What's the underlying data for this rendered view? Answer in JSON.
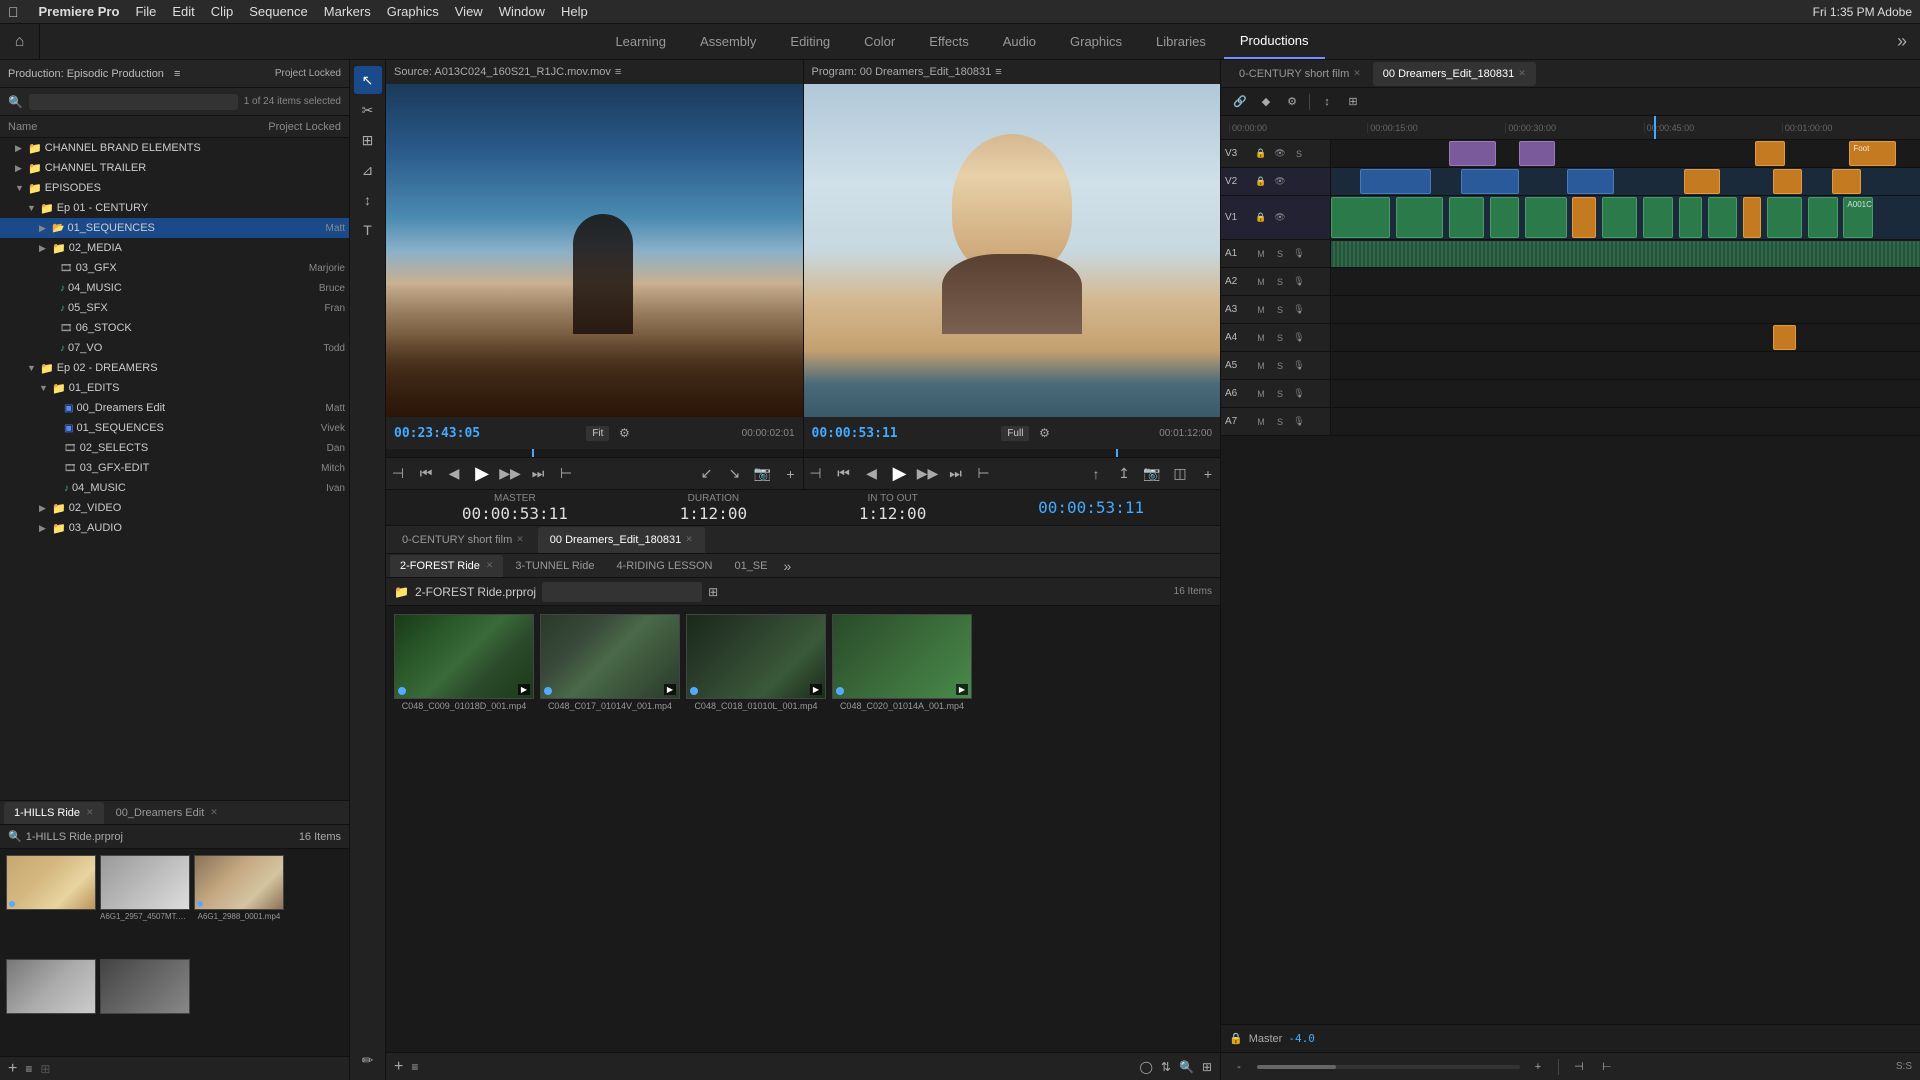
{
  "menubar": {
    "apple": "",
    "app_name": "Premiere Pro",
    "items": [
      "File",
      "Edit",
      "Clip",
      "Sequence",
      "Markers",
      "Graphics",
      "View",
      "Window",
      "Help"
    ],
    "right": "Fri 1:35 PM   Adobe"
  },
  "workspace": {
    "home_icon": "⌂",
    "tabs": [
      {
        "label": "Learning",
        "active": false
      },
      {
        "label": "Assembly",
        "active": false
      },
      {
        "label": "Editing",
        "active": false
      },
      {
        "label": "Color",
        "active": false
      },
      {
        "label": "Effects",
        "active": false
      },
      {
        "label": "Audio",
        "active": false
      },
      {
        "label": "Graphics",
        "active": false
      },
      {
        "label": "Libraries",
        "active": false
      },
      {
        "label": "Productions",
        "active": true
      }
    ],
    "more": "»"
  },
  "project_panel": {
    "title": "Production: Episodic Production",
    "locked": "Project Locked",
    "search_placeholder": "",
    "items_count": "1 of 24 items selected",
    "col_name": "Name",
    "tree": [
      {
        "level": 0,
        "type": "folder",
        "label": "CHANNEL BRAND ELEMENTS",
        "user": ""
      },
      {
        "level": 0,
        "type": "folder",
        "label": "CHANNEL TRAILER",
        "user": ""
      },
      {
        "level": 0,
        "type": "folder",
        "label": "EPISODES",
        "user": "",
        "expanded": true
      },
      {
        "level": 1,
        "type": "folder",
        "label": "Ep 01 - CENTURY",
        "user": "",
        "expanded": true
      },
      {
        "level": 2,
        "type": "folder-seq",
        "label": "01_SEQUENCES",
        "user": "Matt",
        "selected": true
      },
      {
        "level": 2,
        "type": "folder",
        "label": "02_MEDIA",
        "user": ""
      },
      {
        "level": 2,
        "type": "file",
        "label": "03_GFX",
        "user": "Marjorie"
      },
      {
        "level": 2,
        "type": "file",
        "label": "04_MUSIC",
        "user": "Bruce"
      },
      {
        "level": 2,
        "type": "file",
        "label": "05_SFX",
        "user": "Fran"
      },
      {
        "level": 2,
        "type": "file",
        "label": "06_STOCK",
        "user": ""
      },
      {
        "level": 2,
        "type": "file",
        "label": "07_VO",
        "user": "Todd"
      },
      {
        "level": 1,
        "type": "folder",
        "label": "Ep 02 - DREAMERS",
        "user": "",
        "expanded": true
      },
      {
        "level": 2,
        "type": "folder",
        "label": "01_EDITS",
        "user": "",
        "expanded": true
      },
      {
        "level": 3,
        "type": "seq",
        "label": "00_Dreamers Edit",
        "user": "Matt"
      },
      {
        "level": 3,
        "type": "seq",
        "label": "01_SEQUENCES",
        "user": "Vivek"
      },
      {
        "level": 3,
        "type": "file",
        "label": "02_SELECTS",
        "user": "Dan"
      },
      {
        "level": 3,
        "type": "file",
        "label": "03_GFX-EDIT",
        "user": "Mitch"
      },
      {
        "level": 3,
        "type": "file",
        "label": "04_MUSIC",
        "user": "Ivan"
      },
      {
        "level": 2,
        "type": "folder",
        "label": "02_VIDEO",
        "user": ""
      },
      {
        "level": 2,
        "type": "folder",
        "label": "03_AUDIO",
        "user": ""
      }
    ]
  },
  "source_monitor": {
    "label": "Source: A013C024_160S21_R1JC.mov.mov",
    "timecode": "00:23:43:05",
    "scale": "Fit",
    "duration": "00:00:02:01"
  },
  "program_monitor": {
    "label": "Program: 00 Dreamers_Edit_180831",
    "timecode": "00:00:53:11",
    "scale": "Full",
    "duration": "00:01:12:00"
  },
  "timing": {
    "master_label": "MASTER",
    "master_value": "00:00:53:11",
    "duration_label": "DURATION",
    "duration_value": "1:12:00",
    "in_to_out_label": "IN TO OUT",
    "in_to_out_value": "1:12:00",
    "timecode_blue": "00:00:53:11"
  },
  "sequence_tabs": [
    {
      "label": "0-CENTURY short film",
      "active": false
    },
    {
      "label": "00 Dreamers_Edit_180831",
      "active": true
    }
  ],
  "bin_panel": {
    "tabs": [
      {
        "label": "2-FOREST Ride",
        "active": true
      },
      {
        "label": "3-TUNNEL Ride"
      },
      {
        "label": "4-RIDING LESSON"
      },
      {
        "label": "01_SE"
      }
    ],
    "bin_path": "2-FOREST Ride.prproj",
    "items_count": "16 Items",
    "thumbnails": [
      {
        "label": "C048_C009_01018D_001.mp4",
        "type": "forest",
        "badge": ""
      },
      {
        "label": "C048_C017_01014V_001.mp4",
        "type": "road",
        "badge": ""
      },
      {
        "label": "C048_C018_01010L_001.mp4",
        "type": "bike",
        "badge": ""
      },
      {
        "label": "C048_C020_01014A_001.mp4",
        "type": "blur",
        "badge": ""
      }
    ]
  },
  "bottom_left": {
    "tabs": [
      {
        "label": "1-HILLS Ride",
        "active": true
      },
      {
        "label": "00_Dreamers Edit"
      }
    ],
    "bin_path": "1-HILLS Ride.prproj",
    "items_count": "16 Items",
    "thumbs": [
      {
        "type": "desert",
        "label": ""
      },
      {
        "type": "white-clip",
        "label": "A6G1_2957_4507MT.mp4"
      },
      {
        "type": "desert2",
        "label": "A6G1_2988_0001.mp4"
      },
      {
        "type": "wind",
        "label": ""
      },
      {
        "type": "person",
        "label": ""
      },
      {
        "type": "desert3",
        "label": ""
      }
    ]
  },
  "timeline": {
    "tabs": [
      {
        "label": "0-CENTURY short film",
        "active": false
      },
      {
        "label": "00 Dreamers_Edit_180831",
        "active": true
      }
    ],
    "ruler": [
      "00:00:00",
      "00:00:15:00",
      "00:00:30:00",
      "00:00:45:00",
      "00:01:00:00"
    ],
    "tracks": [
      {
        "name": "V3",
        "type": "video"
      },
      {
        "name": "V2",
        "type": "video",
        "highlighted": true
      },
      {
        "name": "V1",
        "type": "video",
        "highlighted": true
      },
      {
        "name": "A1",
        "type": "audio"
      },
      {
        "name": "A2",
        "type": "audio"
      },
      {
        "name": "A3",
        "type": "audio"
      },
      {
        "name": "A4",
        "type": "audio"
      },
      {
        "name": "A5",
        "type": "audio"
      },
      {
        "name": "A6",
        "type": "audio"
      },
      {
        "name": "A7",
        "type": "audio"
      }
    ],
    "master": "Master",
    "master_volume": "-4.0"
  },
  "tools": {
    "items": [
      "↖",
      "✂",
      "⊞",
      "⊿",
      "↕",
      "T"
    ]
  }
}
